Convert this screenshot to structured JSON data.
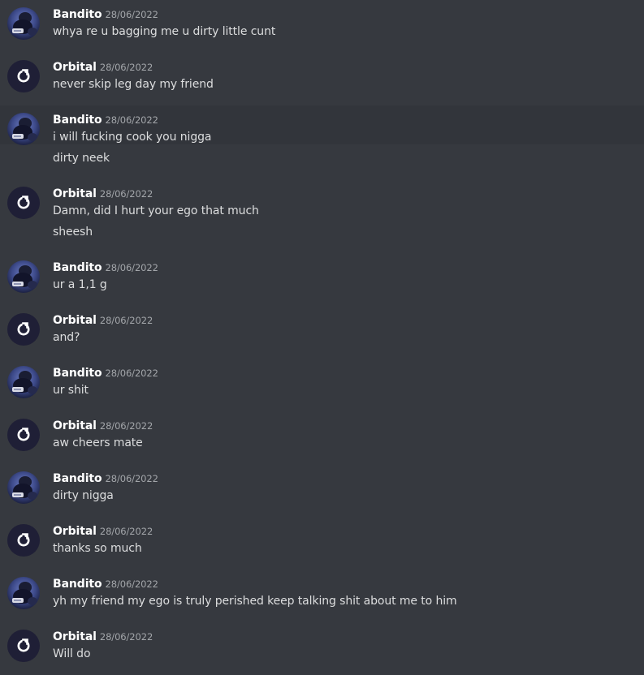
{
  "users": {
    "bandito": {
      "name": "Bandito",
      "avatar_icon": "bandito-avatar-icon"
    },
    "orbital": {
      "name": "Orbital",
      "avatar_icon": "orbital-logo-icon"
    }
  },
  "colors": {
    "background": "#36393f",
    "highlight_row": "#32353b",
    "username": "#ffffff",
    "timestamp": "#a3a6aa",
    "message_text": "#dcddde"
  },
  "messages": [
    {
      "author": "Bandito",
      "timestamp": "28/06/2022",
      "lines": [
        "whya re u bagging me u dirty little cunt"
      ]
    },
    {
      "author": "Orbital",
      "timestamp": "28/06/2022",
      "lines": [
        "never skip leg day my friend"
      ]
    },
    {
      "author": "Bandito",
      "timestamp": "28/06/2022",
      "lines": [
        "i will fucking cook you nigga",
        "dirty neek"
      ]
    },
    {
      "author": "Orbital",
      "timestamp": "28/06/2022",
      "lines": [
        "Damn, did I hurt your ego that much",
        "sheesh"
      ]
    },
    {
      "author": "Bandito",
      "timestamp": "28/06/2022",
      "lines": [
        "ur a 1,1 g"
      ]
    },
    {
      "author": "Orbital",
      "timestamp": "28/06/2022",
      "lines": [
        "and?"
      ]
    },
    {
      "author": "Bandito",
      "timestamp": "28/06/2022",
      "lines": [
        "ur shit"
      ]
    },
    {
      "author": "Orbital",
      "timestamp": "28/06/2022",
      "lines": [
        "aw cheers mate"
      ]
    },
    {
      "author": "Bandito",
      "timestamp": "28/06/2022",
      "lines": [
        "dirty nigga"
      ]
    },
    {
      "author": "Orbital",
      "timestamp": "28/06/2022",
      "lines": [
        "thanks so much"
      ]
    },
    {
      "author": "Bandito",
      "timestamp": "28/06/2022",
      "lines": [
        "yh my friend my ego is truly perished keep talking shit about me to him"
      ]
    },
    {
      "author": "Orbital",
      "timestamp": "28/06/2022",
      "lines": [
        "Will do"
      ]
    }
  ]
}
